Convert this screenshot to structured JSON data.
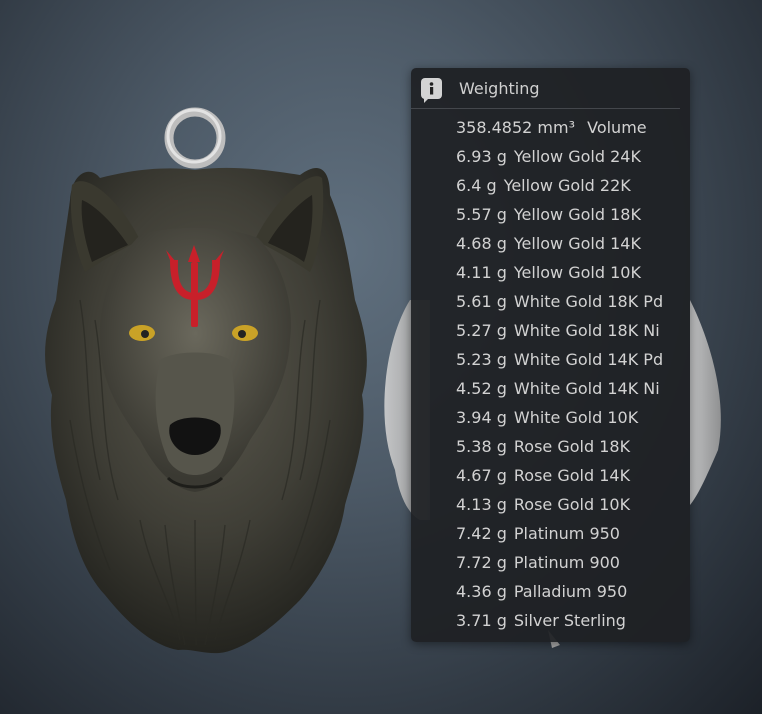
{
  "panel": {
    "title": "Weighting",
    "icon": "info-speech-icon"
  },
  "volume": {
    "value": "358.4852 mm³",
    "label": "Volume"
  },
  "weights": [
    {
      "value": "6.93 g",
      "metal": "Yellow Gold 24K"
    },
    {
      "value": "6.4 g",
      "metal": "Yellow Gold 22K"
    },
    {
      "value": "5.57 g",
      "metal": "Yellow Gold 18K"
    },
    {
      "value": "4.68 g",
      "metal": "Yellow Gold 14K"
    },
    {
      "value": "4.11 g",
      "metal": "Yellow Gold 10K"
    },
    {
      "value": "5.61 g",
      "metal": "White Gold 18K Pd"
    },
    {
      "value": "5.27 g",
      "metal": "White Gold 18K Ni"
    },
    {
      "value": "5.23 g",
      "metal": "White Gold 14K Pd"
    },
    {
      "value": "4.52 g",
      "metal": "White Gold 14K Ni"
    },
    {
      "value": "3.94 g",
      "metal": "White Gold 10K"
    },
    {
      "value": "5.38 g",
      "metal": "Rose Gold 18K"
    },
    {
      "value": "4.67 g",
      "metal": "Rose Gold 14K"
    },
    {
      "value": "4.13 g",
      "metal": "Rose Gold 10K"
    },
    {
      "value": "7.42 g",
      "metal": "Platinum 950"
    },
    {
      "value": "7.72 g",
      "metal": "Platinum 900"
    },
    {
      "value": "4.36 g",
      "metal": "Palladium 950"
    },
    {
      "value": "3.71 g",
      "metal": "Silver Sterling"
    }
  ],
  "colors": {
    "panel_bg": "#1e2024",
    "text": "#d2d2d2",
    "trident_mark": "#c8202a",
    "wolf_eyes": "#c9a227"
  }
}
